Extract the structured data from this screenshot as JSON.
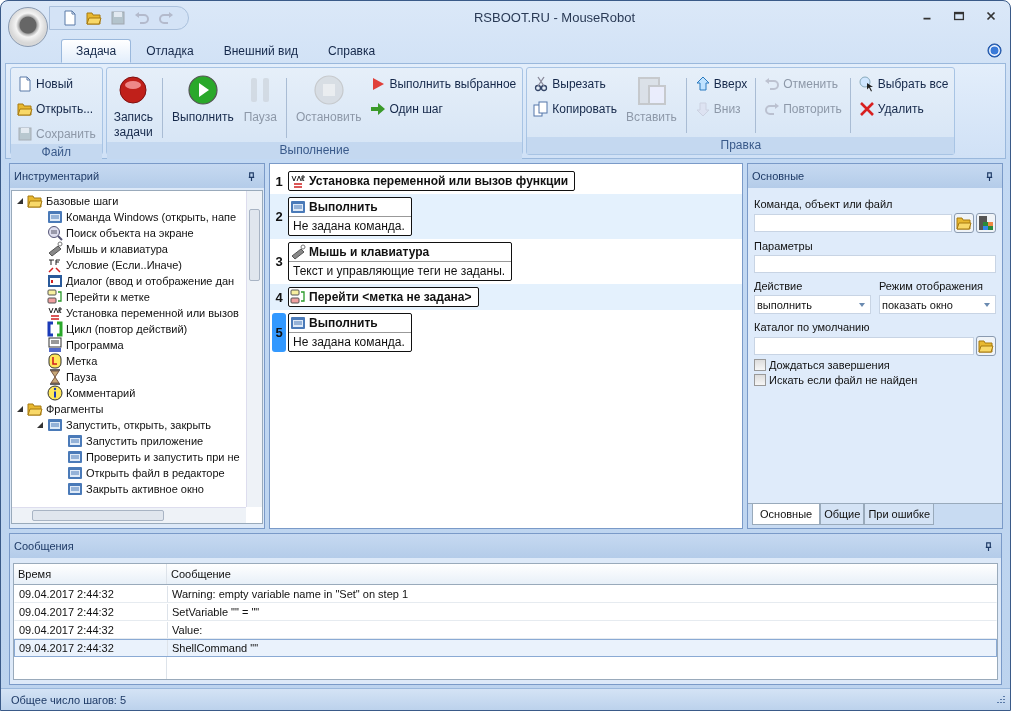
{
  "window": {
    "title": "RSBOOT.RU - MouseRobot"
  },
  "quick_access": [
    {
      "kind": "new",
      "disabled": false
    },
    {
      "kind": "open",
      "disabled": false
    },
    {
      "kind": "save",
      "disabled": true
    },
    {
      "kind": "undo",
      "disabled": true
    },
    {
      "kind": "redo",
      "disabled": true
    }
  ],
  "tabs": [
    {
      "label": "Задача",
      "selected": true
    },
    {
      "label": "Отладка",
      "selected": false
    },
    {
      "label": "Внешний вид",
      "selected": false
    },
    {
      "label": "Справка",
      "selected": false
    }
  ],
  "ribbon": [
    {
      "label": "Файл",
      "columns": [
        {
          "kind": "small",
          "items": [
            {
              "label": "Новый",
              "kind": "new",
              "disabled": false
            },
            {
              "label": "Открыть...",
              "kind": "open",
              "disabled": false
            },
            {
              "label": "Сохранить",
              "kind": "save",
              "disabled": true
            }
          ]
        }
      ]
    },
    {
      "label": "Выполнение",
      "columns": [
        {
          "kind": "large",
          "items": [
            {
              "label": "Запись задачи",
              "kind": "record",
              "disabled": false
            }
          ]
        },
        {
          "kind": "separator"
        },
        {
          "kind": "large",
          "items": [
            {
              "label": "Выполнить",
              "kind": "run",
              "disabled": false
            }
          ]
        },
        {
          "kind": "large",
          "items": [
            {
              "label": "Пауза",
              "kind": "pause",
              "disabled": true
            }
          ]
        },
        {
          "kind": "separator"
        },
        {
          "kind": "large",
          "items": [
            {
              "label": "Остановить",
              "kind": "stop",
              "disabled": true
            }
          ]
        },
        {
          "kind": "small",
          "items": [
            {
              "label": "Выполнить выбранное",
              "kind": "runsel",
              "disabled": false
            },
            {
              "label": "Один шаг",
              "kind": "step",
              "disabled": false
            }
          ]
        }
      ]
    },
    {
      "label": "Правка",
      "columns": [
        {
          "kind": "small",
          "items": [
            {
              "label": "Вырезать",
              "kind": "cut",
              "disabled": false
            },
            {
              "label": "Копировать",
              "kind": "copy",
              "disabled": false
            }
          ]
        },
        {
          "kind": "large",
          "items": [
            {
              "label": "Вставить",
              "kind": "paste",
              "disabled": true
            }
          ]
        },
        {
          "kind": "separator"
        },
        {
          "kind": "small",
          "items": [
            {
              "label": "Вверх",
              "kind": "up",
              "disabled": false
            },
            {
              "label": "Вниз",
              "kind": "down",
              "disabled": true
            }
          ]
        },
        {
          "kind": "separator"
        },
        {
          "kind": "small",
          "items": [
            {
              "label": "Отменить",
              "kind": "undo",
              "disabled": true
            },
            {
              "label": "Повторить",
              "kind": "redo",
              "disabled": true
            }
          ]
        },
        {
          "kind": "separator"
        },
        {
          "kind": "small",
          "items": [
            {
              "label": "Выбрать все",
              "kind": "selall",
              "disabled": false
            },
            {
              "label": "Удалить",
              "kind": "delete",
              "disabled": false
            }
          ]
        }
      ]
    }
  ],
  "toolbox": {
    "title": "Инструментарий",
    "tree": [
      {
        "label": "Базовые шаги",
        "kind": "folder",
        "expanded": true,
        "children": [
          {
            "label": "Команда Windows (открыть, напе",
            "kind": "window"
          },
          {
            "label": "Поиск объекта на экране",
            "kind": "search"
          },
          {
            "label": "Мышь и клавиатура",
            "kind": "mouse"
          },
          {
            "label": "Условие (Если..Иначе)",
            "kind": "condition"
          },
          {
            "label": "Диалог (ввод и отображение дан",
            "kind": "dialog"
          },
          {
            "label": "Перейти к метке",
            "kind": "goto"
          },
          {
            "label": "Установка переменной или вызов",
            "kind": "var"
          },
          {
            "label": "Цикл (повтор действий)",
            "kind": "loop"
          },
          {
            "label": "Программа",
            "kind": "program"
          },
          {
            "label": "Метка",
            "kind": "label"
          },
          {
            "label": "Пауза",
            "kind": "pause"
          },
          {
            "label": "Комментарий",
            "kind": "comment"
          }
        ]
      },
      {
        "label": "Фрагменты",
        "kind": "folder",
        "expanded": true,
        "children": [
          {
            "label": "Запустить, открыть, закрыть",
            "kind": "window",
            "expanded": true,
            "children": [
              {
                "label": "Запустить приложение",
                "kind": "window"
              },
              {
                "label": "Проверить и запустить при не",
                "kind": "window"
              },
              {
                "label": "Открыть файл в редакторе",
                "kind": "window"
              },
              {
                "label": "Закрыть активное окно",
                "kind": "window"
              }
            ]
          }
        ]
      }
    ]
  },
  "steps": [
    {
      "number": "1",
      "kind": "var",
      "title": "Установка переменной или вызов функции",
      "selected": false
    },
    {
      "number": "2",
      "kind": "window",
      "title": "Выполнить",
      "detail": "Не задана команда.",
      "selected": false
    },
    {
      "number": "3",
      "kind": "mouse",
      "title": "Мышь и клавиатура",
      "detail": "Текст и управляющие теги не заданы.",
      "selected": false
    },
    {
      "number": "4",
      "kind": "goto",
      "title": "Перейти <метка не задана>",
      "selected": false
    },
    {
      "number": "5",
      "kind": "window",
      "title": "Выполнить",
      "detail": "Не задана команда.",
      "selected": true
    }
  ],
  "properties": {
    "title": "Основные",
    "command_label": "Команда, объект или файл",
    "params_label": "Параметры",
    "action": {
      "label": "Действие",
      "value": "выполнить"
    },
    "display_mode": {
      "label": "Режим отображения",
      "value": "показать окно"
    },
    "dir_label": "Каталог по умолчанию",
    "checkboxes": [
      {
        "label": "Дождаться завершения",
        "checked": false
      },
      {
        "label": "Искать если файл не найден",
        "checked": false
      }
    ],
    "tabs": [
      {
        "label": "Основные",
        "selected": true
      },
      {
        "label": "Общие",
        "selected": false
      },
      {
        "label": "При ошибке",
        "selected": false
      }
    ]
  },
  "messages": {
    "title": "Сообщения",
    "columns": [
      "Время",
      "Сообщение"
    ],
    "rows": [
      {
        "time": "09.04.2017 2:44:32",
        "message": "Warning: empty variable name in \"Set\" on step 1",
        "selected": false
      },
      {
        "time": "09.04.2017 2:44:32",
        "message": "SetVariable \"\" = \"\"",
        "selected": false
      },
      {
        "time": "09.04.2017 2:44:32",
        "message": "Value:",
        "selected": false
      },
      {
        "time": "09.04.2017 2:44:32",
        "message": "ShellCommand \"\"",
        "selected": true
      }
    ]
  },
  "status_bar": "Общее число шагов: 5"
}
